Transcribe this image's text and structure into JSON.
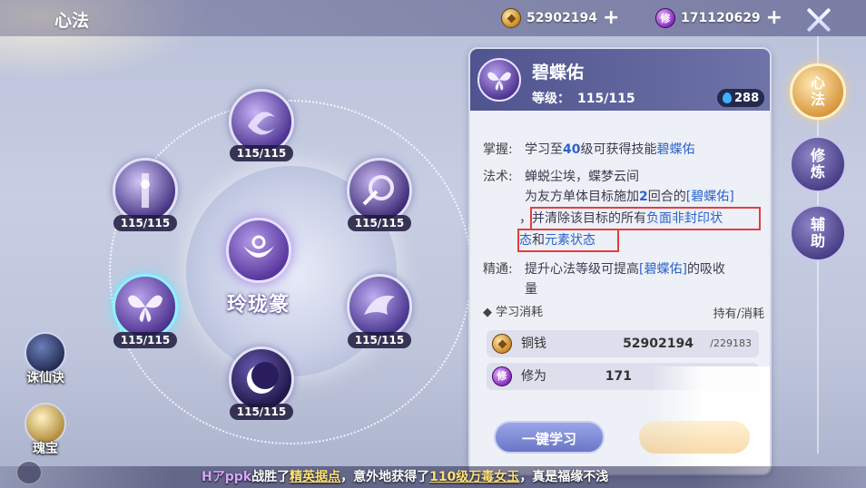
{
  "header": {
    "title": "心法",
    "coins": "52902194",
    "cultivation_icon": "修",
    "cultivation": "171120629"
  },
  "side_icons": [
    {
      "label": "诛仙诀"
    },
    {
      "label": "瑰宝"
    }
  ],
  "ring": {
    "center_name": "玲珑篆",
    "nodes": [
      {
        "id": "top",
        "level": "115/115"
      },
      {
        "id": "upper-left",
        "level": "115/115"
      },
      {
        "id": "upper-right",
        "level": "115/115"
      },
      {
        "id": "lower-left",
        "level": "115/115"
      },
      {
        "id": "lower-right",
        "level": "115/115"
      },
      {
        "id": "bottom",
        "level": "115/115"
      }
    ]
  },
  "panel": {
    "name": "碧蝶佑",
    "level_label": "等级：",
    "level_value": "115/115",
    "power": "288",
    "mastery_label": "掌握:",
    "mastery_pre": "学习至",
    "mastery_lvl": "40",
    "mastery_mid": "级可获得技能",
    "mastery_skill": "碧蝶佑",
    "art_label": "法术:",
    "art_line1": "蝉蜕尘埃，蝶梦云间",
    "art_line2_pre": "为友方单体目标施加",
    "art_line2_num": "2",
    "art_line2_mid": "回合的",
    "art_line2_skill": "[碧蝶佑]",
    "art_line3_pre": "，并清除该目标的所有",
    "art_line3_blue": "负面非封印状",
    "art_line4_blue1": "态",
    "art_line4_mid": "和",
    "art_line4_blue2": "元素状态",
    "refine_label": "精通:",
    "refine_pre": "提升心法等级可提高",
    "refine_skill": "[碧蝶佑]",
    "refine_post": "的吸收",
    "refine_line2": "量",
    "cost_title": "学习消耗",
    "cost_right": "持有/消耗",
    "cost_coin_name": "铜钱",
    "cost_coin_have": "52902194",
    "cost_coin_need": "/229183",
    "cost_cult_icon": "修",
    "cost_cult_name": "修为",
    "cost_cult_have": "171",
    "learn_button": "一键学习"
  },
  "tabs": [
    {
      "label": "心法",
      "active": true
    },
    {
      "label": "修炼",
      "active": false
    },
    {
      "label": "辅助",
      "active": false
    }
  ],
  "ticker": {
    "player": "Hアppk",
    "t1": "战胜了",
    "place": "精英据点",
    "t2": "，意外地获得了",
    "item": "110级万毒女玉",
    "t3": "，真是福缘不浅"
  }
}
